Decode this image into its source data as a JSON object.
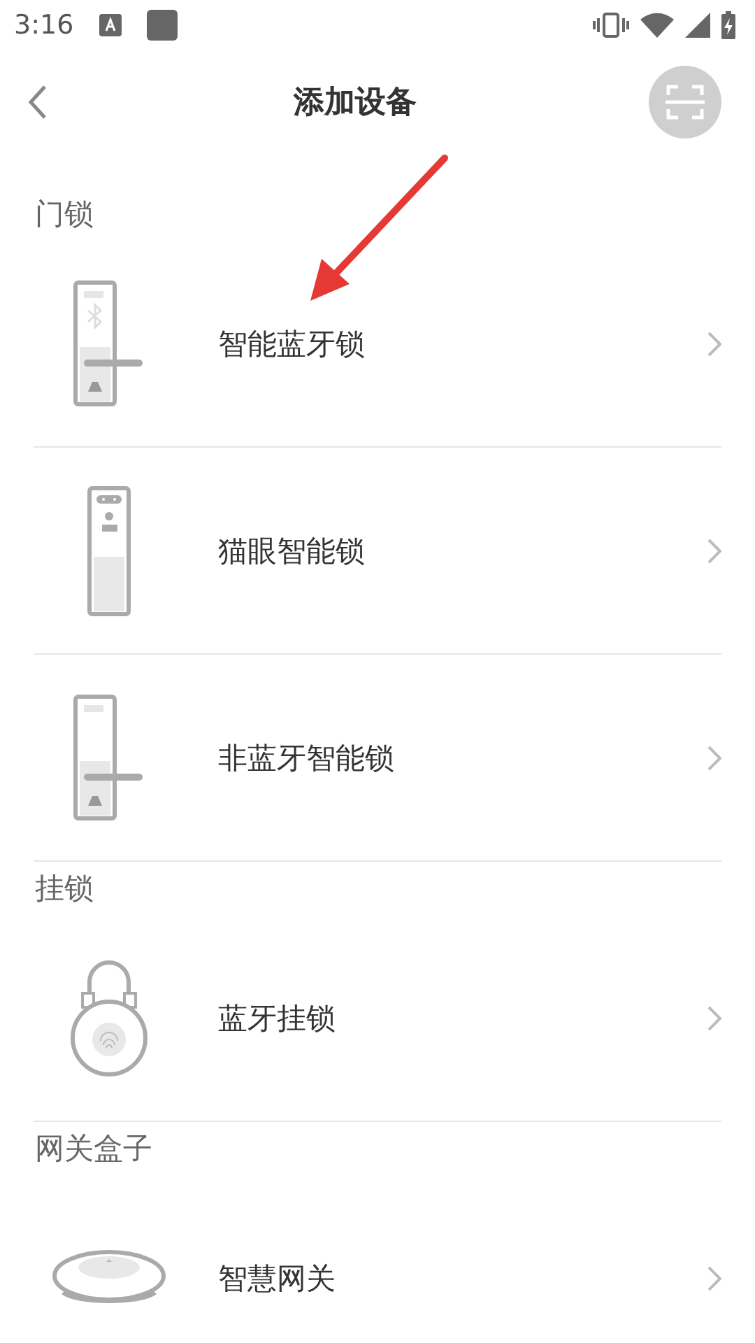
{
  "status_bar": {
    "time": "3:16"
  },
  "header": {
    "title": "添加设备"
  },
  "sections": [
    {
      "title": "门锁",
      "items": [
        {
          "name": "智能蓝牙锁",
          "kind": "bluetooth-door-lock"
        },
        {
          "name": "猫眼智能锁",
          "kind": "peephole-lock"
        },
        {
          "name": "非蓝牙智能锁",
          "kind": "door-lock"
        }
      ]
    },
    {
      "title": "挂锁",
      "items": [
        {
          "name": "蓝牙挂锁",
          "kind": "padlock"
        }
      ]
    },
    {
      "title": "网关盒子",
      "items": [
        {
          "name": "智慧网关",
          "kind": "gateway"
        }
      ]
    }
  ]
}
